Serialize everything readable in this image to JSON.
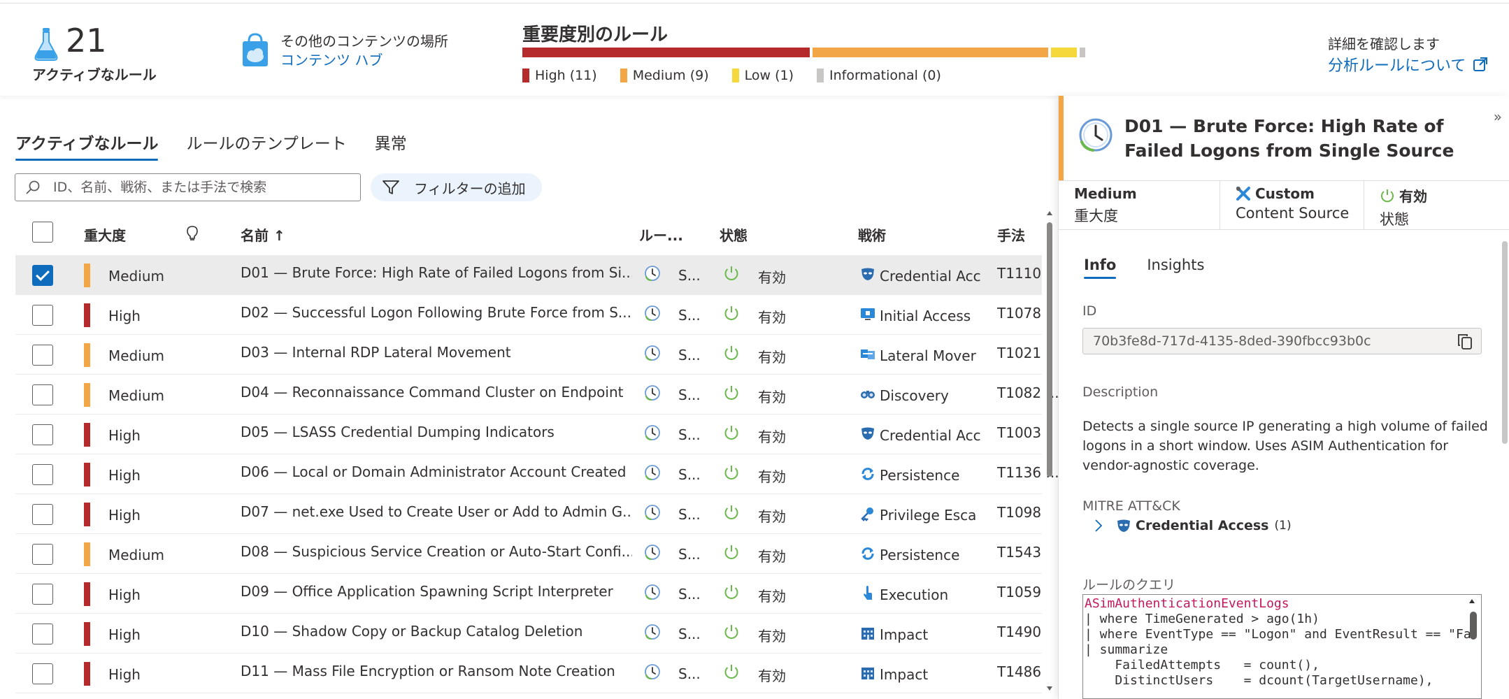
{
  "summary": {
    "active_count": "21",
    "active_label": "アクティブなルール",
    "hub_title": "その他のコンテンツの場所",
    "hub_link": "コンテンツ ハブ",
    "severity_title": "重要度別のルール",
    "severity": [
      {
        "label": "High (11)",
        "value": 11,
        "color": "#b52a2a"
      },
      {
        "label": "Medium (9)",
        "value": 9,
        "color": "#f2a645"
      },
      {
        "label": "Low (1)",
        "value": 1,
        "color": "#f5d83b"
      },
      {
        "label": "Informational (0)",
        "value": 0,
        "color": "#c8c6c4"
      }
    ],
    "more_title": "詳細を確認します",
    "more_link": "分析ルールについて"
  },
  "tabs": [
    "アクティブなルール",
    "ルールのテンプレート",
    "異常"
  ],
  "search": {
    "placeholder": "ID、名前、戦術、または手法で検索"
  },
  "filter_label": "フィルターの追加",
  "columns": {
    "severity": "重大度",
    "name": "名前 ↑",
    "rule_type": "ルー...",
    "state": "状態",
    "tactics": "戦術",
    "techniques": "手法"
  },
  "rows": [
    {
      "severity": "Medium",
      "sev_color": "#f2a645",
      "name": "D01 — Brute Force: High Rate of Failed Logons from Si...",
      "type": "S...",
      "state": "有効",
      "tactic": "Credential Acc",
      "tactic_icon": "mask-icon",
      "technique": "T1110",
      "selected": true
    },
    {
      "severity": "High",
      "sev_color": "#b52a2a",
      "name": "D02 — Successful Logon Following Brute Force from S...",
      "type": "S...",
      "state": "有効",
      "tactic": "Initial Access",
      "tactic_icon": "screen-lock-icon",
      "technique": "T1078",
      "selected": false
    },
    {
      "severity": "Medium",
      "sev_color": "#f2a645",
      "name": "D03 — Internal RDP Lateral Movement",
      "type": "S...",
      "state": "有効",
      "tactic": "Lateral Mover",
      "tactic_icon": "transfer-icon",
      "technique": "T1021",
      "selected": false
    },
    {
      "severity": "Medium",
      "sev_color": "#f2a645",
      "name": "D04 — Reconnaissance Command Cluster on Endpoint",
      "type": "S...",
      "state": "有効",
      "tactic": "Discovery",
      "tactic_icon": "binoculars-icon",
      "technique": "T1082 ...",
      "selected": false
    },
    {
      "severity": "High",
      "sev_color": "#b52a2a",
      "name": "D05 — LSASS Credential Dumping Indicators",
      "type": "S...",
      "state": "有効",
      "tactic": "Credential Acc",
      "tactic_icon": "mask-icon",
      "technique": "T1003",
      "selected": false
    },
    {
      "severity": "High",
      "sev_color": "#b52a2a",
      "name": "D06 — Local or Domain Administrator Account Created",
      "type": "S...",
      "state": "有効",
      "tactic": "Persistence",
      "tactic_icon": "cycle-icon",
      "technique": "T1136 ...",
      "selected": false
    },
    {
      "severity": "High",
      "sev_color": "#b52a2a",
      "name": "D07 — net.exe Used to Create User or Add to Admin G...",
      "type": "S...",
      "state": "有効",
      "tactic": "Privilege Esca",
      "tactic_icon": "key-icon",
      "technique": "T1098",
      "selected": false
    },
    {
      "severity": "Medium",
      "sev_color": "#f2a645",
      "name": "D08 — Suspicious Service Creation or Auto-Start Confi...",
      "type": "S...",
      "state": "有効",
      "tactic": "Persistence",
      "tactic_icon": "cycle-icon",
      "technique": "T1543",
      "selected": false
    },
    {
      "severity": "High",
      "sev_color": "#b52a2a",
      "name": "D09 — Office Application Spawning Script Interpreter",
      "type": "S...",
      "state": "有効",
      "tactic": "Execution",
      "tactic_icon": "pointer-icon",
      "technique": "T1059",
      "selected": false
    },
    {
      "severity": "High",
      "sev_color": "#b52a2a",
      "name": "D10 — Shadow Copy or Backup Catalog Deletion",
      "type": "S...",
      "state": "有効",
      "tactic": "Impact",
      "tactic_icon": "building-icon",
      "technique": "T1490",
      "selected": false
    },
    {
      "severity": "High",
      "sev_color": "#b52a2a",
      "name": "D11 — Mass File Encryption or Ransom Note Creation",
      "type": "S...",
      "state": "有効",
      "tactic": "Impact",
      "tactic_icon": "building-icon",
      "technique": "T1486",
      "selected": false
    }
  ],
  "details": {
    "title": "D01 — Brute Force: High Rate of Failed Logons from Single Source",
    "severity_value": "Medium",
    "severity_key": "重大度",
    "source_value": "Custom",
    "source_key": "Content Source",
    "state_value": "有効",
    "state_key": "状態",
    "tabs": [
      "Info",
      "Insights"
    ],
    "id_label": "ID",
    "id_value": "70b3fe8d-717d-4135-8ded-390fbcc93b0c",
    "description_label": "Description",
    "description": "Detects a single source IP generating a high volume of failed logons in a short window. Uses ASIM Authentication for vendor-agnostic coverage.",
    "mitre_label": "MITRE ATT&CK",
    "mitre_tactic": "Credential Access",
    "mitre_count": "(1)",
    "query_label": "ルールのクエリ",
    "query_lines": [
      "ASimAuthenticationEventLogs",
      "| where TimeGenerated > ago(1h)",
      "| where EventType == \"Logon\" and EventResult == \"Fa",
      "| summarize",
      "    FailedAttempts   = count(),",
      "    DistinctUsers    = dcount(TargetUsername),"
    ]
  }
}
